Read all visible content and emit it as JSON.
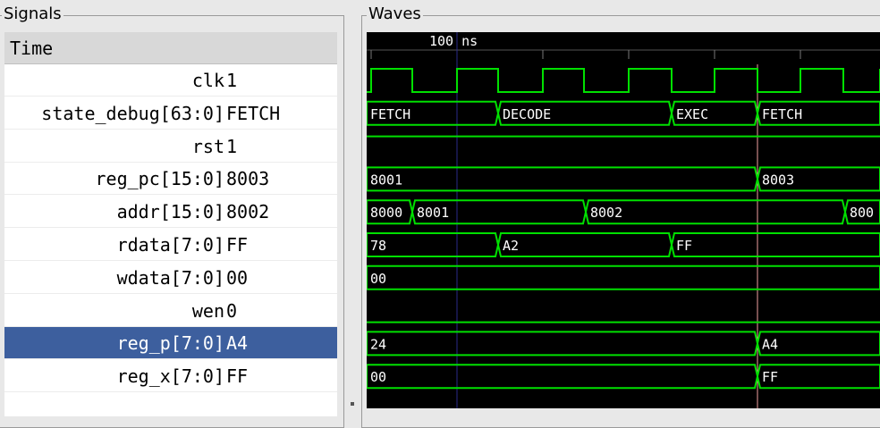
{
  "panels": {
    "signals_title": "Signals",
    "waves_title": "Waves"
  },
  "signals": {
    "header": "Time",
    "rows": [
      {
        "name": "clk",
        "value": "1",
        "selected": false
      },
      {
        "name": "state_debug[63:0]",
        "value": "FETCH",
        "selected": false
      },
      {
        "name": "rst",
        "value": "1",
        "selected": false
      },
      {
        "name": "reg_pc[15:0]",
        "value": "8003",
        "selected": false
      },
      {
        "name": "addr[15:0]",
        "value": "8002",
        "selected": false
      },
      {
        "name": "rdata[7:0]",
        "value": "FF",
        "selected": false
      },
      {
        "name": "wdata[7:0]",
        "value": "00",
        "selected": false
      },
      {
        "name": "wen",
        "value": "0",
        "selected": false
      },
      {
        "name": "reg_p[7:0]",
        "value": "A4",
        "selected": true
      },
      {
        "name": "reg_x[7:0]",
        "value": "FF",
        "selected": false
      }
    ]
  },
  "waves": {
    "time_label": "100 ns",
    "colors": {
      "background": "#000000",
      "trace": "#00e000",
      "marker": "#f0a0a0",
      "grid": "#2a2a8a",
      "ruler_text": "#ffffff"
    },
    "buses": [
      {
        "row": 1,
        "segments": [
          {
            "label": "FETCH"
          },
          {
            "label": "DECODE"
          },
          {
            "label": "EXEC"
          },
          {
            "label": "FETCH"
          }
        ]
      },
      {
        "row": 3,
        "segments": [
          {
            "label": "8001"
          },
          {
            "label": "8003"
          }
        ]
      },
      {
        "row": 4,
        "segments": [
          {
            "label": "8000"
          },
          {
            "label": "8001"
          },
          {
            "label": "8002"
          },
          {
            "label": "800"
          }
        ]
      },
      {
        "row": 5,
        "segments": [
          {
            "label": "78"
          },
          {
            "label": "A2"
          },
          {
            "label": "FF"
          }
        ]
      },
      {
        "row": 6,
        "segments": [
          {
            "label": "00"
          }
        ]
      },
      {
        "row": 8,
        "segments": [
          {
            "label": "24"
          },
          {
            "label": "A4"
          }
        ]
      },
      {
        "row": 9,
        "segments": [
          {
            "label": "00"
          },
          {
            "label": "FF"
          }
        ]
      }
    ]
  }
}
